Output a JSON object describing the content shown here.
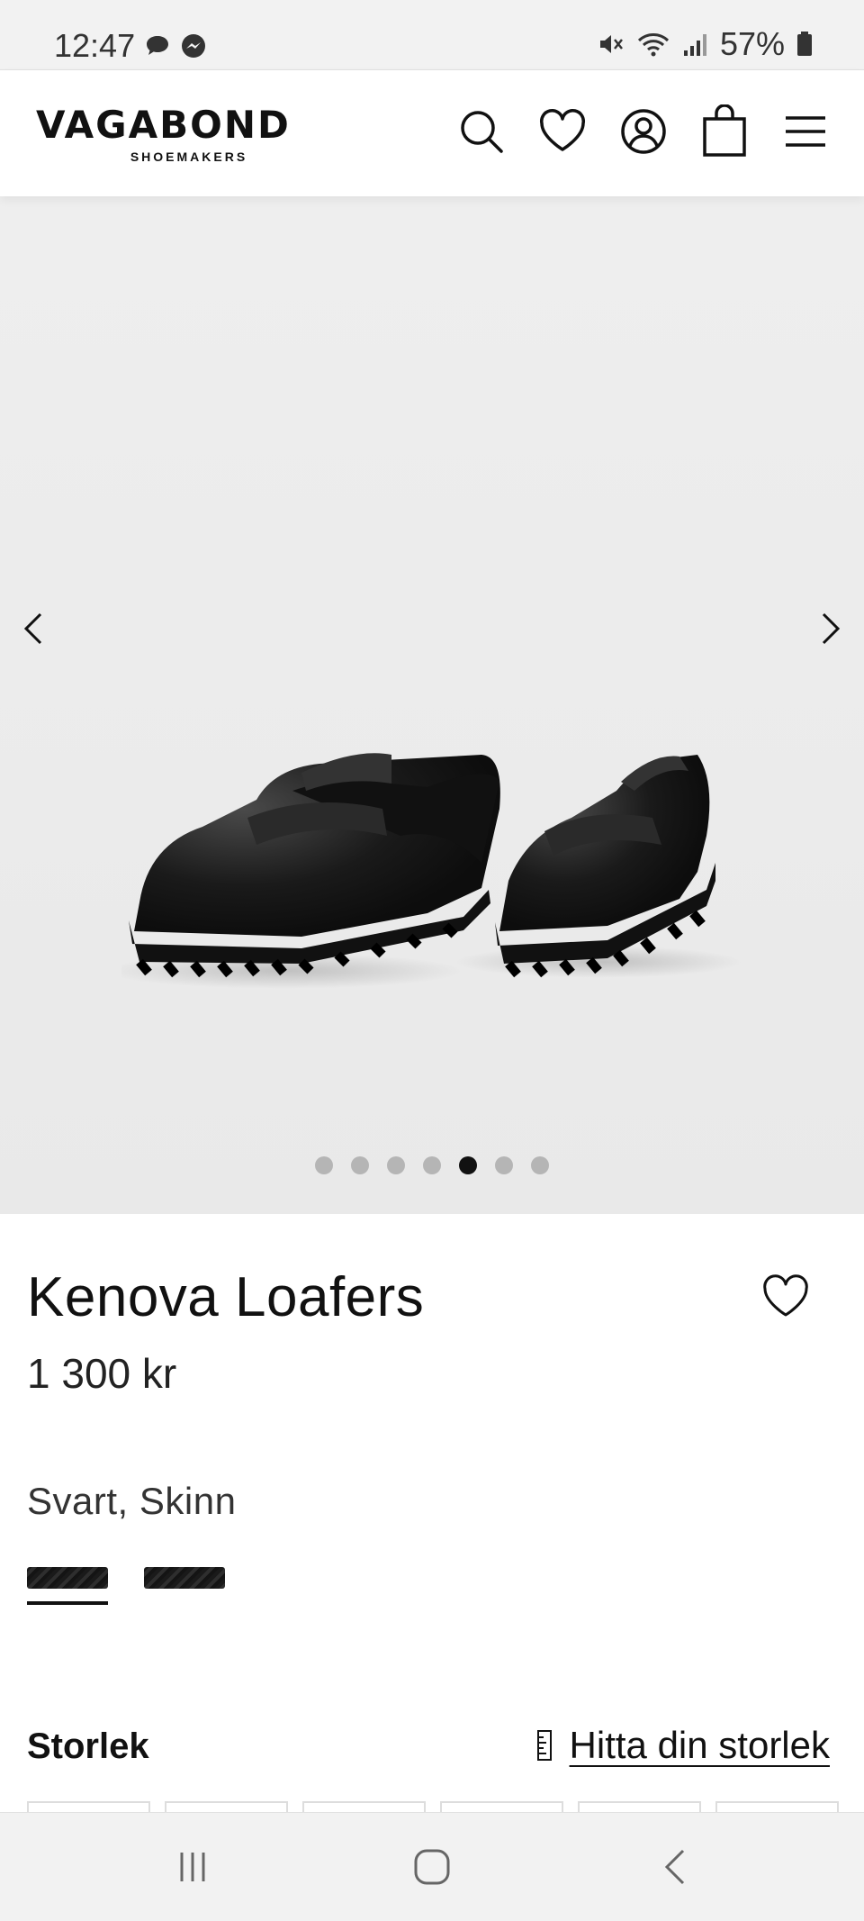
{
  "status_bar": {
    "time": "12:47",
    "battery": "57%",
    "icons": [
      "chat-bubble-icon",
      "messenger-icon",
      "mute-icon",
      "wifi-icon",
      "signal-icon",
      "battery-icon"
    ]
  },
  "header": {
    "logo_main": "VAGABOND",
    "logo_sub": "SHOEMAKERS",
    "icons": [
      "search-icon",
      "heart-icon",
      "account-icon",
      "bag-icon",
      "menu-icon"
    ]
  },
  "gallery": {
    "image_count": 7,
    "active_index": 4
  },
  "product": {
    "title": "Kenova Loafers",
    "price": "1 300 kr",
    "color": "Svart, Skinn"
  },
  "size": {
    "label": "Storlek",
    "guide_link": "Hitta din storlek"
  },
  "colors": {
    "accent": "#111111",
    "background": "#ffffff",
    "gallery_bg": "#ececec",
    "dot_inactive": "#b5b5b5"
  }
}
